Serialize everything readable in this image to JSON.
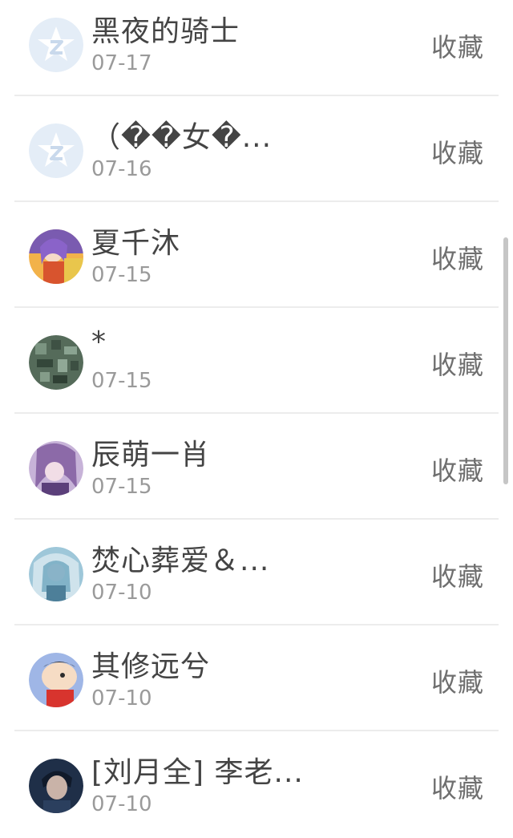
{
  "items": [
    {
      "name": "黑夜的骑士",
      "date": "07-17",
      "action": "收藏",
      "avatar": "default-qzone-avatar"
    },
    {
      "name": "（��女�...",
      "date": "07-16",
      "action": "收藏",
      "avatar": "default-qzone-avatar"
    },
    {
      "name": "夏千沐",
      "date": "07-15",
      "action": "收藏",
      "avatar": "anime-girl-avatar"
    },
    {
      "name": "*",
      "date": "07-15",
      "action": "收藏",
      "avatar": "green-pattern-avatar"
    },
    {
      "name": "辰萌一肖",
      "date": "07-15",
      "action": "收藏",
      "avatar": "purple-anime-avatar"
    },
    {
      "name": "焚心葬爱＆...",
      "date": "07-10",
      "action": "收藏",
      "avatar": "blue-anime-avatar"
    },
    {
      "name": "其修远兮",
      "date": "07-10",
      "action": "收藏",
      "avatar": "cartoon-avatar"
    },
    {
      "name": "[刘月全] 李老...",
      "date": "07-10",
      "action": "收藏",
      "avatar": "portrait-avatar"
    }
  ],
  "colors": {
    "name_text": "#444444",
    "date_text": "#9a9a9a",
    "action_text": "#6f6f6f",
    "divider": "#ececec",
    "default_avatar_bg": "#e4edf7",
    "default_avatar_star": "#ffffff"
  }
}
